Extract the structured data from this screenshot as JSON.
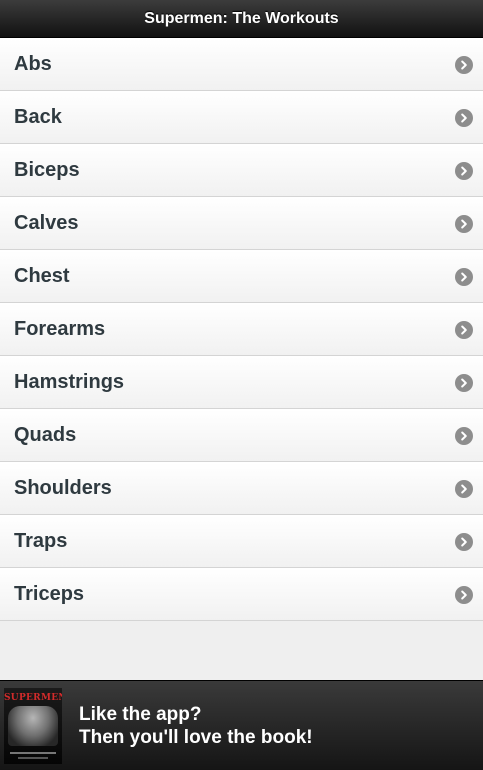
{
  "header": {
    "title": "Supermen: The Workouts"
  },
  "workouts": [
    {
      "label": "Abs"
    },
    {
      "label": "Back"
    },
    {
      "label": "Biceps"
    },
    {
      "label": "Calves"
    },
    {
      "label": "Chest"
    },
    {
      "label": "Forearms"
    },
    {
      "label": "Hamstrings"
    },
    {
      "label": "Quads"
    },
    {
      "label": "Shoulders"
    },
    {
      "label": "Traps"
    },
    {
      "label": "Triceps"
    }
  ],
  "icons": {
    "row_icon": "chevron-right-icon",
    "cover": "book-cover-image"
  },
  "promo": {
    "line1": "Like the app?",
    "line2": "Then you'll love the book!",
    "cover_title": "SUPERMEN"
  },
  "colors": {
    "header_bg": "#1f1f1f",
    "list_bg": "#f6f6f6",
    "label": "#2f3a40",
    "chevron": "#8d8d8d",
    "cover_accent": "#d22b2b"
  }
}
